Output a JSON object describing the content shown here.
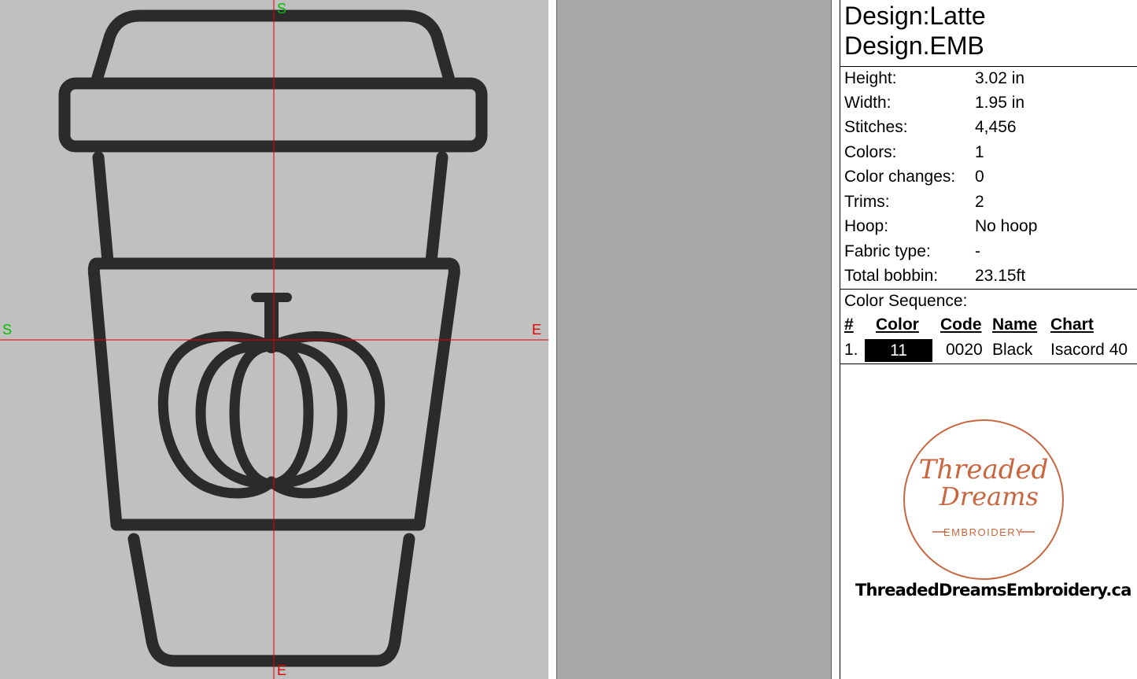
{
  "canvas": {
    "top_label": "S",
    "bottom_label": "E",
    "left_label": "S",
    "right_label": "E",
    "crosshair_color": "#e00000",
    "background": "#c0c0c0",
    "stitch_color": "#2b2b2b",
    "design_icon": "latte-cup-with-pumpkin"
  },
  "panel": {
    "title_line1": "Design:Latte",
    "title_line2": "Design.EMB",
    "properties": [
      {
        "key": "Height:",
        "value": "3.02 in"
      },
      {
        "key": "Width:",
        "value": "1.95 in"
      },
      {
        "key": "Stitches:",
        "value": "4,456"
      },
      {
        "key": "Colors:",
        "value": "1"
      },
      {
        "key": "Color changes:",
        "value": "0"
      },
      {
        "key": "Trims:",
        "value": "2"
      },
      {
        "key": "Hoop:",
        "value": "No hoop"
      },
      {
        "key": "Fabric type:",
        "value": "-"
      },
      {
        "key": "Total bobbin:",
        "value": "23.15ft"
      }
    ],
    "color_sequence": {
      "title": "Color Sequence:",
      "headers": {
        "num": "#",
        "color": "Color",
        "code": "Code",
        "name": "Name",
        "chart": "Chart"
      },
      "rows": [
        {
          "num": "1.",
          "color_label": "11",
          "swatch": "#000000",
          "code": "0020",
          "name": "Black",
          "chart": "Isacord 40"
        }
      ]
    },
    "logo": {
      "line1": "Threaded",
      "line2": "Dreams",
      "line3": "EMBROIDERY",
      "color": "#c8663f"
    },
    "website": "ThreadedDreamsEmbroidery.ca"
  }
}
